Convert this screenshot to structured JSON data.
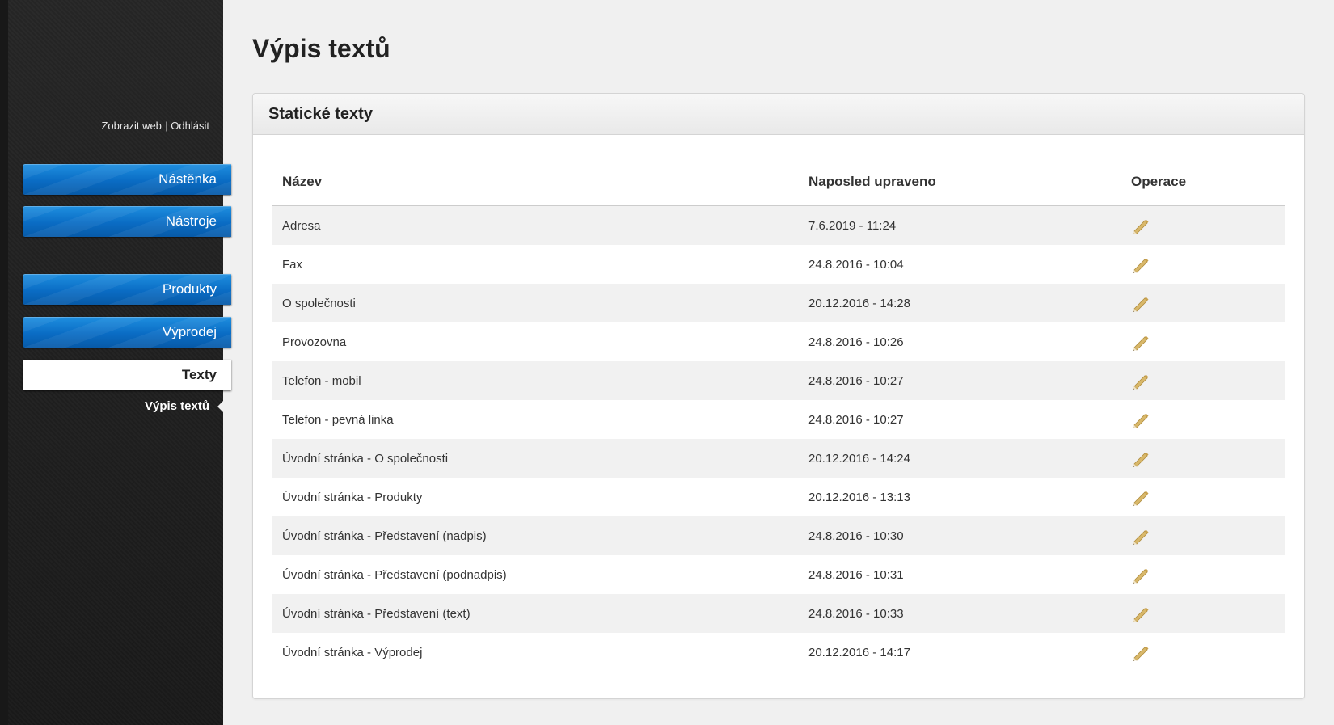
{
  "header": {
    "links": {
      "view_web": "Zobrazit web",
      "separator": "|",
      "logout": "Odhlásit"
    }
  },
  "sidebar": {
    "items": [
      {
        "label": "Nástěnka",
        "active": false
      },
      {
        "label": "Nástroje",
        "active": false
      },
      {
        "label": "Produkty",
        "active": false
      },
      {
        "label": "Výprodej",
        "active": false
      },
      {
        "label": "Texty",
        "active": true
      }
    ],
    "subitems": [
      {
        "label": "Výpis textů",
        "active": true
      }
    ]
  },
  "main": {
    "title": "Výpis textů",
    "panel": {
      "title": "Statické texty",
      "columns": {
        "name": "Název",
        "modified": "Naposled upraveno",
        "actions": "Operace"
      },
      "rows": [
        {
          "name": "Adresa",
          "modified": "7.6.2019 - 11:24"
        },
        {
          "name": "Fax",
          "modified": "24.8.2016 - 10:04"
        },
        {
          "name": "O společnosti",
          "modified": "20.12.2016 - 14:28"
        },
        {
          "name": "Provozovna",
          "modified": "24.8.2016 - 10:26"
        },
        {
          "name": "Telefon - mobil",
          "modified": "24.8.2016 - 10:27"
        },
        {
          "name": "Telefon - pevná linka",
          "modified": "24.8.2016 - 10:27"
        },
        {
          "name": "Úvodní stránka - O společnosti",
          "modified": "20.12.2016 - 14:24"
        },
        {
          "name": "Úvodní stránka - Produkty",
          "modified": "20.12.2016 - 13:13"
        },
        {
          "name": "Úvodní stránka - Představení (nadpis)",
          "modified": "24.8.2016 - 10:30"
        },
        {
          "name": "Úvodní stránka - Představení (podnadpis)",
          "modified": "24.8.2016 - 10:31"
        },
        {
          "name": "Úvodní stránka - Představení (text)",
          "modified": "24.8.2016 - 10:33"
        },
        {
          "name": "Úvodní stránka - Výprodej",
          "modified": "20.12.2016 - 14:17"
        }
      ],
      "row_action_icon": "pencil-icon"
    }
  },
  "colors": {
    "sidebar_bg": "#1e1e1e",
    "nav_blue": "#0a6cc4",
    "content_bg": "#f0f0f0",
    "row_alt": "#f1f1f1",
    "pencil_wood": "#d9b86a",
    "pencil_tip": "#7a6a4a"
  }
}
